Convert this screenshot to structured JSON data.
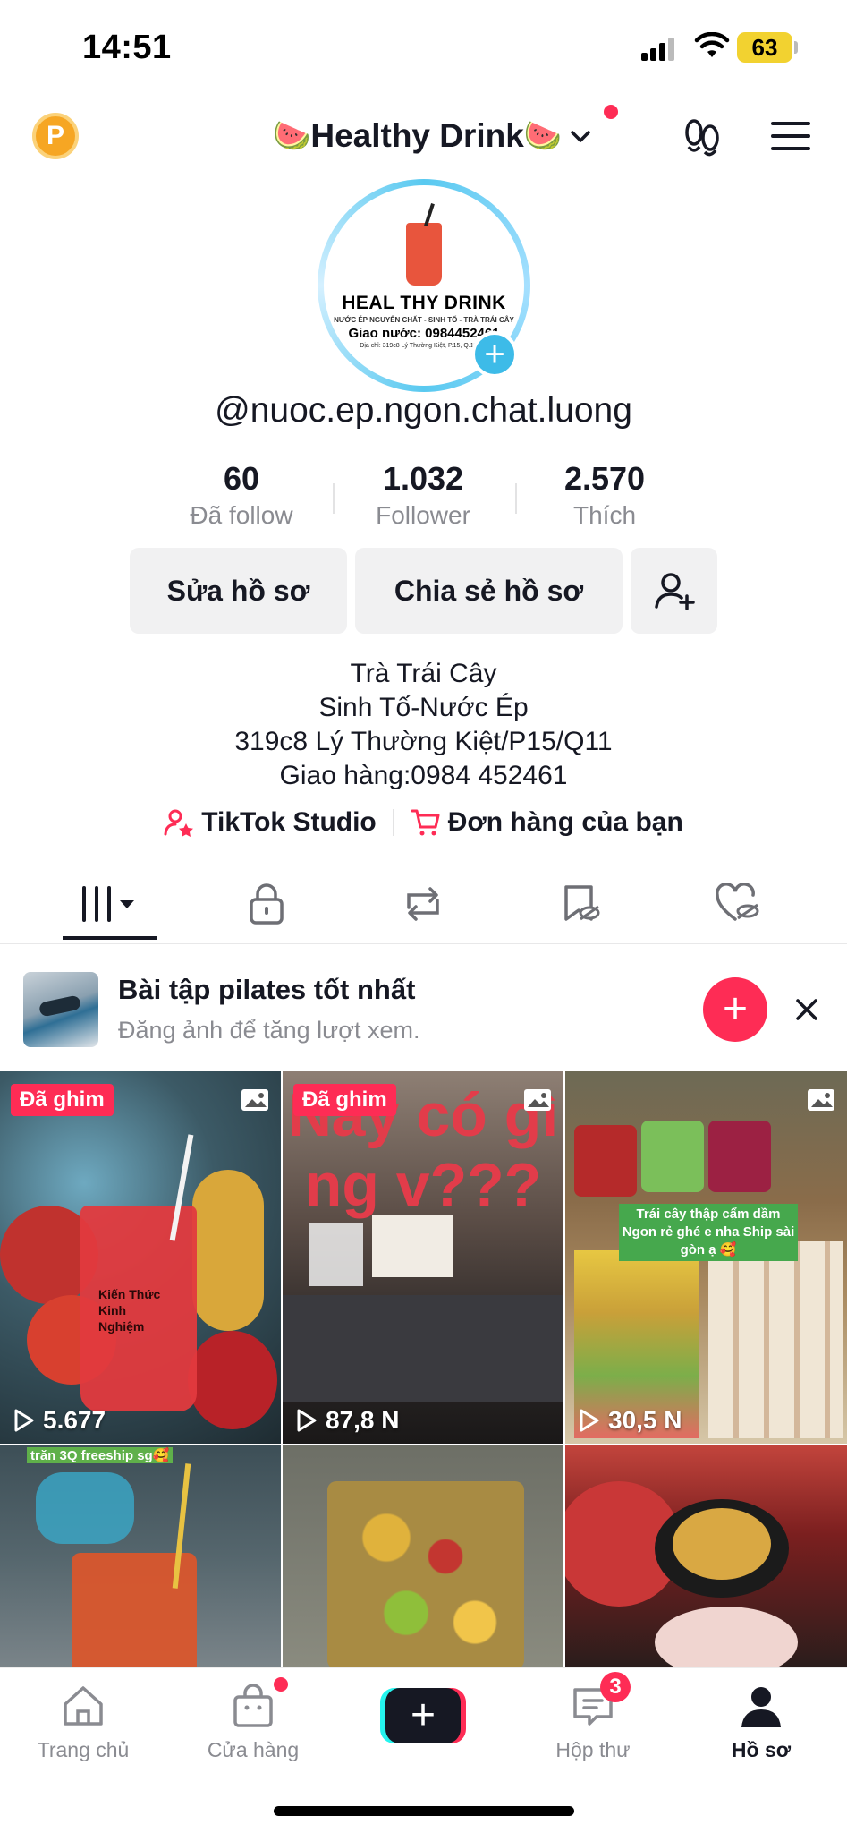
{
  "status_bar": {
    "time": "14:51",
    "battery": "63"
  },
  "header": {
    "coin_letter": "P",
    "title_left_emoji": "🍉",
    "title": "Healthy Drink",
    "title_right_emoji": "🍉"
  },
  "avatar": {
    "logo_text": "HEAL THY DRINK",
    "sub_text": "NƯỚC ÉP NGUYÊN CHẤT - SINH TỐ - TRÀ TRÁI CÂY",
    "phone_text": "Giao nước: 0984452461",
    "address_text": "Địa chỉ: 319c8 Lý Thường Kiệt, P.15, Q.11, TP",
    "plus": "+"
  },
  "profile": {
    "username": "@nuoc.ep.ngon.chat.luong"
  },
  "stats": [
    {
      "value": "60",
      "label": "Đã follow"
    },
    {
      "value": "1.032",
      "label": "Follower"
    },
    {
      "value": "2.570",
      "label": "Thích"
    }
  ],
  "actions": {
    "edit_label": "Sửa hồ sơ",
    "share_label": "Chia sẻ hồ sơ"
  },
  "bio": [
    "Trà Trái Cây",
    "Sinh Tố-Nước Ép",
    "319c8 Lý Thường Kiệt/P15/Q11",
    "Giao hàng:0984 452461"
  ],
  "links": {
    "studio": "TikTok Studio",
    "orders": "Đơn hàng của bạn"
  },
  "suggestion": {
    "title": "Bài tập pilates tốt nhất",
    "subtitle": "Đăng ảnh để tăng lượt xem.",
    "plus": "+"
  },
  "videos": [
    {
      "pinned": "Đã ghim",
      "views": "5.677",
      "overlay": "Kiến Thức Kinh Nghiệm"
    },
    {
      "pinned": "Đã ghim",
      "views": "87,8 N",
      "overlay": "Này có gì ng v???"
    },
    {
      "views": "30,5 N",
      "overlay": "Trái cây thập cẩm dầm Ngon rẻ ghé e nha Ship sài gòn ạ 🥰"
    },
    {
      "overlay": "trăn 3Q freeship sg🥰"
    },
    {},
    {}
  ],
  "bottom_nav": [
    {
      "label": "Trang chủ"
    },
    {
      "label": "Cửa hàng"
    },
    {
      "label": "+"
    },
    {
      "label": "Hộp thư",
      "badge": "3"
    },
    {
      "label": "Hồ sơ"
    }
  ],
  "colors": {
    "accent": "#fe2c55",
    "ring": "#59c9f0",
    "muted": "#8a8b91"
  }
}
